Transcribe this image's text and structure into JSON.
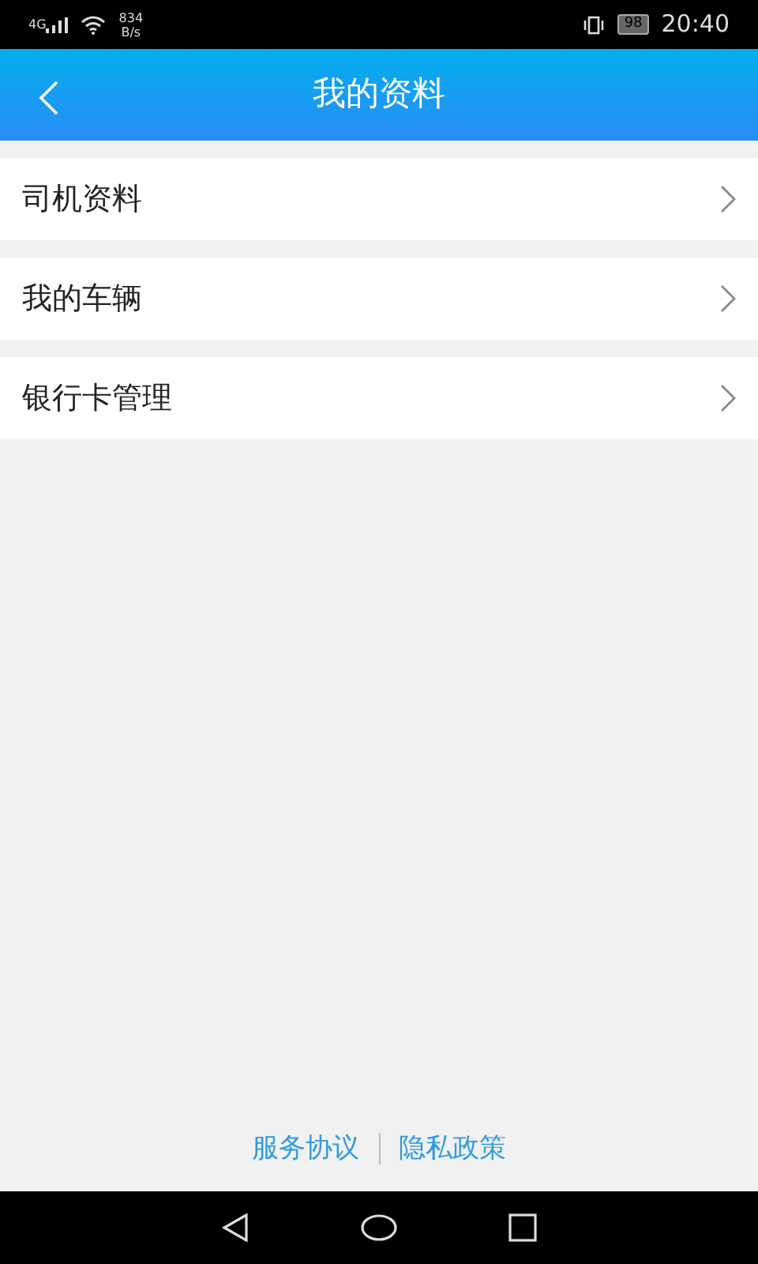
{
  "status_bar": {
    "network": "4G",
    "speed_value": "834",
    "speed_unit": "B/s",
    "battery": "98",
    "time": "20:40"
  },
  "header": {
    "title": "我的资料"
  },
  "menu_items": [
    {
      "label": "司机资料"
    },
    {
      "label": "我的车辆"
    },
    {
      "label": "银行卡管理"
    }
  ],
  "footer_links": [
    "服务协议",
    "隐私政策"
  ]
}
